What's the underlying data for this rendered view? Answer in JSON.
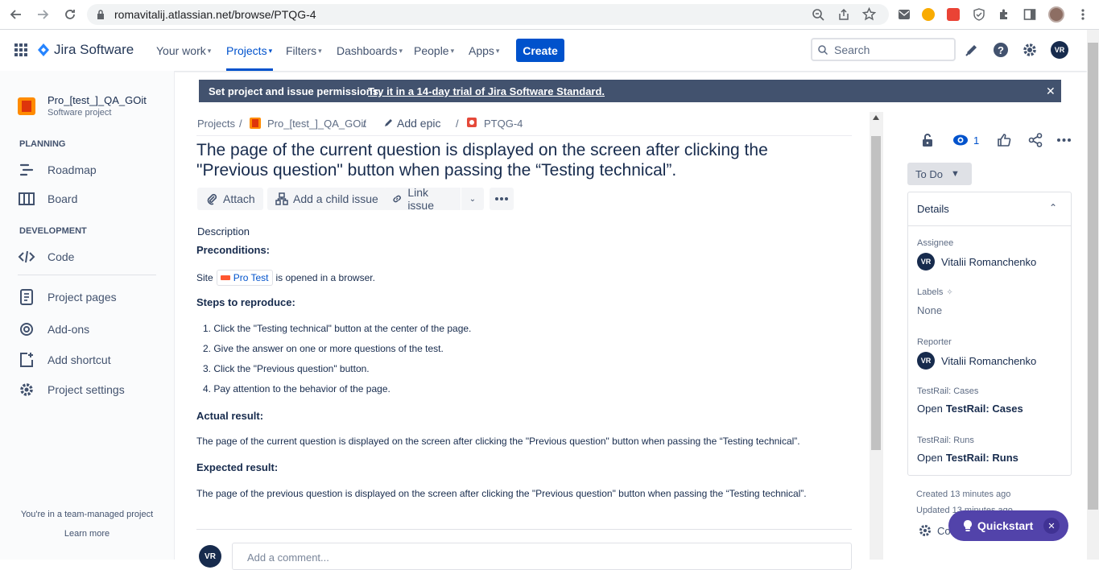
{
  "browser": {
    "url": "romavitalij.atlassian.net/browse/PTQG-4"
  },
  "nav": {
    "product": "Jira Software",
    "items": [
      "Your work",
      "Projects",
      "Filters",
      "Dashboards",
      "People",
      "Apps"
    ],
    "create": "Create",
    "search_placeholder": "Search",
    "avatar": "VR"
  },
  "sidebar": {
    "project_name": "Pro_[test_]_QA_GOit",
    "project_type": "Software project",
    "planning_heading": "PLANNING",
    "roadmap": "Roadmap",
    "board": "Board",
    "development_heading": "DEVELOPMENT",
    "code": "Code",
    "project_pages": "Project pages",
    "addons": "Add-ons",
    "add_shortcut": "Add shortcut",
    "project_settings": "Project settings",
    "team_managed": "You're in a team-managed project",
    "learn_more": "Learn more"
  },
  "banner": {
    "text": "Set project and issue permissions.",
    "link": "Try it in a 14-day trial of Jira Software Standard."
  },
  "breadcrumb": {
    "projects": "Projects",
    "project": "Pro_[test_]_QA_GOit",
    "add_epic": "Add epic",
    "issue_key": "PTQG-4"
  },
  "issue": {
    "title": "The page of the current question is displayed on the screen after clicking the \"Previous question\" button when passing the “Testing technical”.",
    "actions": {
      "attach": "Attach",
      "child": "Add a child issue",
      "link": "Link issue"
    },
    "description_label": "Description",
    "preconditions": "Preconditions:",
    "site_prefix": "Site",
    "site_link": "Pro Test",
    "site_suffix": "is opened in a browser.",
    "steps_heading": "Steps to reproduce:",
    "steps": [
      "1. Click the \"Testing technical\" button at the center of the page.",
      "2. Give the answer on one or more questions of the test.",
      "3. Click the \"Previous question\" button.",
      "4. Pay attention to the behavior of the page."
    ],
    "actual_heading": "Actual result:",
    "actual_text": "The page of the current question is displayed on the screen after clicking the \"Previous question\" button when passing the “Testing technical”.",
    "expected_heading": "Expected result:",
    "expected_text": "The page of the previous question is displayed on the screen after clicking the \"Previous question\" button when passing the “Testing technical”.",
    "comment_placeholder": "Add a comment...",
    "comment_avatar": "VR"
  },
  "panel": {
    "watch_count": "1",
    "status": "To Do",
    "details_heading": "Details",
    "assignee_label": "Assignee",
    "assignee": "Vitalii Romanchenko",
    "labels_label": "Labels",
    "labels_value": "None",
    "reporter_label": "Reporter",
    "reporter": "Vitalii Romanchenko",
    "cases_label": "TestRail: Cases",
    "cases_open": "Open",
    "cases_name": "TestRail: Cases",
    "runs_label": "TestRail: Runs",
    "runs_open": "Open",
    "runs_name": "TestRail: Runs",
    "avatar": "VR",
    "created": "Created 13 minutes ago",
    "updated": "Updated 13 minutes ago",
    "configure": "Configure"
  },
  "quickstart": {
    "label": "Quickstart"
  }
}
